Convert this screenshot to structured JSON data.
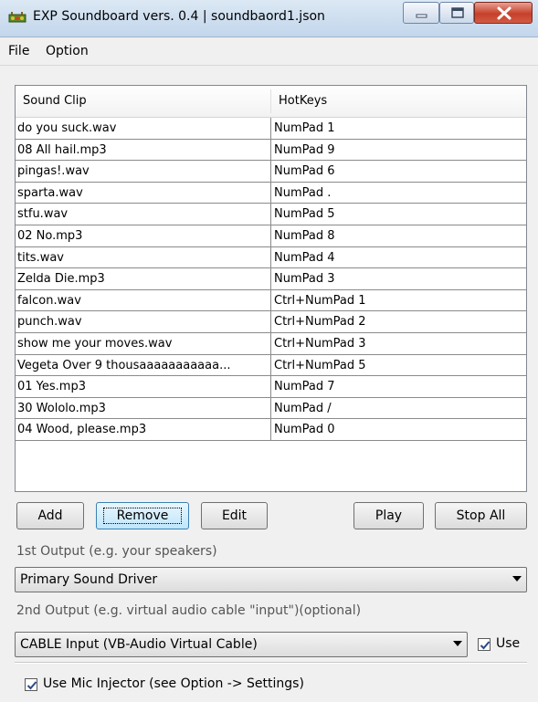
{
  "window": {
    "title": "EXP Soundboard vers. 0.4 | soundbaord1.json"
  },
  "menu": {
    "items": [
      "File",
      "Option"
    ]
  },
  "table": {
    "columns": [
      "Sound Clip",
      "HotKeys"
    ],
    "rows": [
      {
        "clip": "do you suck.wav",
        "hotkey": "NumPad 1"
      },
      {
        "clip": "08 All hail.mp3",
        "hotkey": "NumPad 9"
      },
      {
        "clip": "pingas!.wav",
        "hotkey": "NumPad 6"
      },
      {
        "clip": "sparta.wav",
        "hotkey": "NumPad ."
      },
      {
        "clip": "stfu.wav",
        "hotkey": "NumPad 5"
      },
      {
        "clip": "02 No.mp3",
        "hotkey": "NumPad 8"
      },
      {
        "clip": "tits.wav",
        "hotkey": "NumPad 4"
      },
      {
        "clip": "Zelda  Die.mp3",
        "hotkey": "NumPad 3"
      },
      {
        "clip": "falcon.wav",
        "hotkey": "Ctrl+NumPad 1"
      },
      {
        "clip": "punch.wav",
        "hotkey": "Ctrl+NumPad 2"
      },
      {
        "clip": "show me your moves.wav",
        "hotkey": "Ctrl+NumPad 3"
      },
      {
        "clip": "Vegeta  Over 9 thousaaaaaaaaaaa...",
        "hotkey": "Ctrl+NumPad 5"
      },
      {
        "clip": "01 Yes.mp3",
        "hotkey": "NumPad 7"
      },
      {
        "clip": "30 Wololo.mp3",
        "hotkey": "NumPad /"
      },
      {
        "clip": "04 Wood, please.mp3",
        "hotkey": "NumPad 0"
      }
    ]
  },
  "buttons": {
    "add": "Add",
    "remove": "Remove",
    "edit": "Edit",
    "play": "Play",
    "stop_all": "Stop All"
  },
  "output1": {
    "label": "1st Output (e.g. your speakers)",
    "selected": "Primary Sound Driver"
  },
  "output2": {
    "label": "2nd Output (e.g. virtual audio cable \"input\")(optional)",
    "selected": "CABLE Input (VB-Audio Virtual Cable)",
    "use_label": "Use",
    "use_checked": true
  },
  "mic_injector": {
    "label": "Use Mic Injector (see Option -> Settings)",
    "checked": true
  },
  "colors": {
    "close_button": "#c6402a",
    "title_bar": "#c2d6ec",
    "focus_button": "#bee6fd"
  }
}
